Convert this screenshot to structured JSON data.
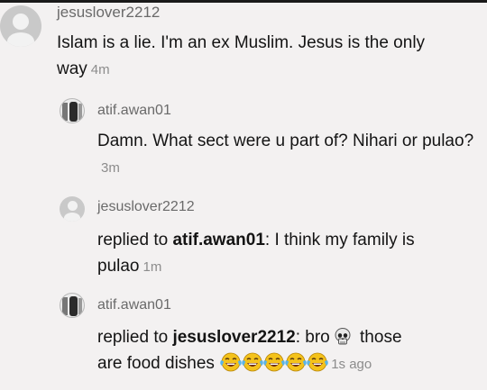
{
  "comments": [
    {
      "username": "jesuslover2212",
      "text": "Islam is a lie. I'm an ex Muslim. Jesus is the only way",
      "time": "4m",
      "avatar": "default-avatar-icon"
    },
    {
      "username": "atif.awan01",
      "text": "Damn. What sect were u part of? Nihari or pulao?",
      "time": "3m",
      "avatar": "photo-avatar"
    },
    {
      "username": "jesuslover2212",
      "replied_prefix": "replied to ",
      "replied_to": "atif.awan01",
      "text": ": I think my family is pulao",
      "time": "1m",
      "avatar": "default-avatar-icon"
    },
    {
      "username": "atif.awan01",
      "replied_prefix": "replied to ",
      "replied_to": "jesuslover2212",
      "text_part1": ": bro",
      "emoji_skull": "skull-emoji",
      "text_part2": "those are food dishes",
      "emoji_laugh_count": 5,
      "emoji_laugh": "face-with-tears-of-joy-emoji",
      "time": "1s ago",
      "avatar": "photo-avatar"
    }
  ],
  "colors": {
    "background": "#f3f1f1",
    "username": "#6a6a6a",
    "text": "#141414",
    "time": "#8c8c8c",
    "emoji_yellow": "#f4c21b"
  }
}
